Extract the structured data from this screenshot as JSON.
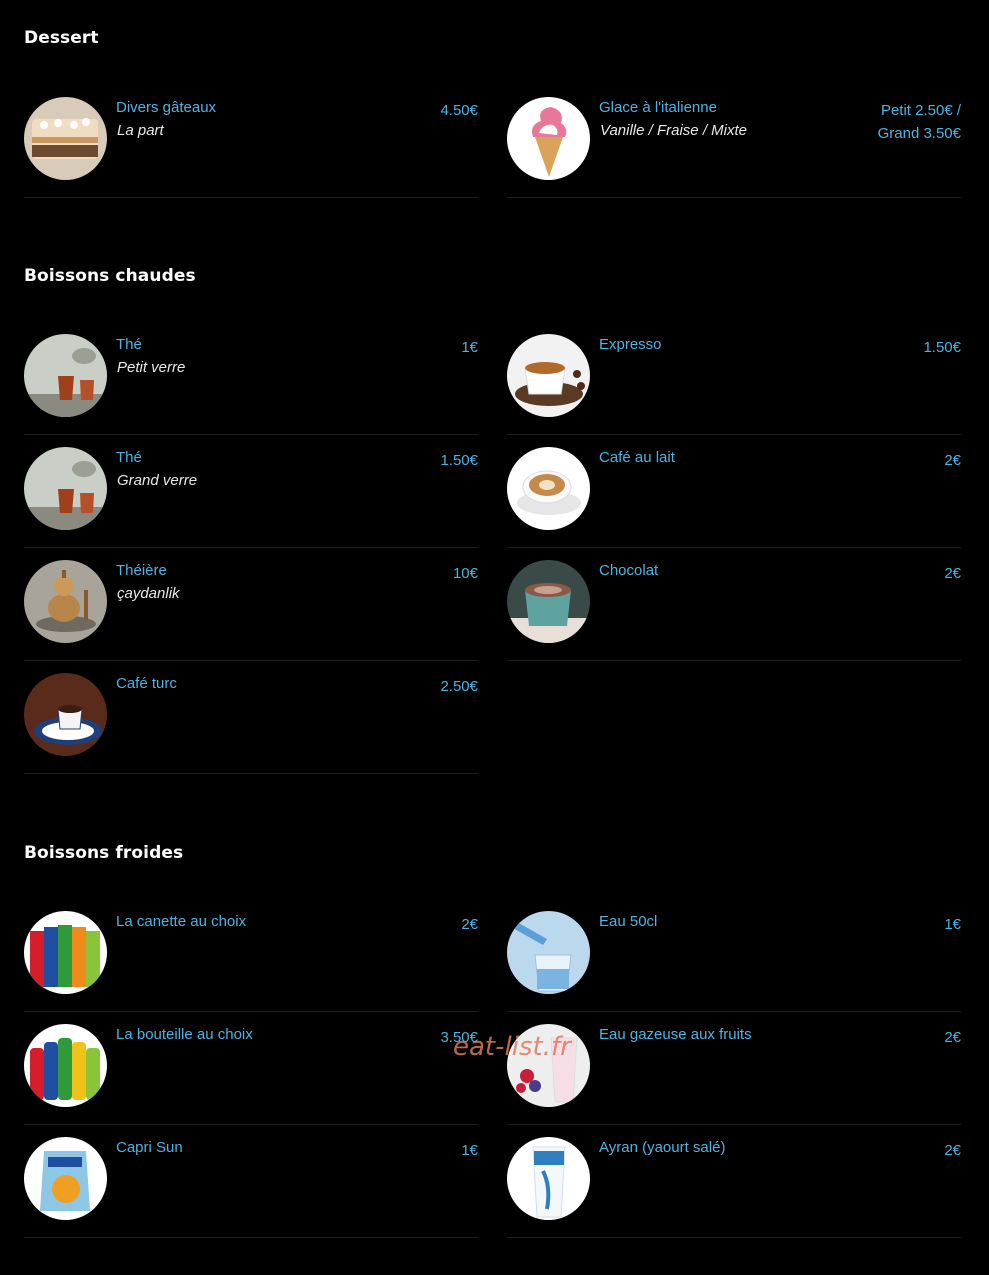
{
  "sections": {
    "dessert": {
      "title": "Dessert",
      "items": [
        {
          "name": "Divers gâteaux",
          "desc": "La part",
          "price": "4.50€",
          "image": "cake-slice-photo"
        },
        {
          "name": "Glace à l'italienne",
          "desc": "Vanille / Fraise / Mixte",
          "price_line1": "Petit 2.50€ /",
          "price_line2": "Grand 3.50€",
          "image": "soft-serve-cone-photo"
        }
      ]
    },
    "chaudes": {
      "title": "Boissons chaudes",
      "items": [
        {
          "name": "Thé",
          "desc": "Petit verre",
          "price": "1€",
          "image": "tea-glass-photo"
        },
        {
          "name": "Expresso",
          "desc": "",
          "price": "1.50€",
          "image": "espresso-cup-photo"
        },
        {
          "name": "Thé",
          "desc": "Grand verre",
          "price": "1.50€",
          "image": "tea-glass-photo"
        },
        {
          "name": "Café au lait",
          "desc": "",
          "price": "2€",
          "image": "latte-cup-photo"
        },
        {
          "name": "Théière",
          "desc": "çaydanlik",
          "price": "10€",
          "image": "teapot-photo"
        },
        {
          "name": "Chocolat",
          "desc": "",
          "price": "2€",
          "image": "hot-chocolate-photo"
        },
        {
          "name": "Café turc",
          "desc": "",
          "price": "2.50€",
          "image": "turkish-coffee-photo"
        }
      ]
    },
    "froides": {
      "title": "Boissons froides",
      "items": [
        {
          "name": "La canette au choix",
          "desc": "",
          "price": "2€",
          "image": "soda-cans-photo"
        },
        {
          "name": "Eau 50cl",
          "desc": "",
          "price": "1€",
          "image": "water-pour-photo"
        },
        {
          "name": "La bouteille au choix",
          "desc": "",
          "price": "3.50€",
          "image": "soda-bottles-photo"
        },
        {
          "name": "Eau gazeuse aux fruits",
          "desc": "",
          "price": "2€",
          "image": "sparkling-fruit-water-photo"
        },
        {
          "name": "Capri Sun",
          "desc": "",
          "price": "1€",
          "image": "capri-sun-photo"
        },
        {
          "name": "Ayran (yaourt salé)",
          "desc": "",
          "price": "2€",
          "image": "ayran-cup-photo"
        }
      ]
    }
  },
  "watermark": "eat-list.fr"
}
